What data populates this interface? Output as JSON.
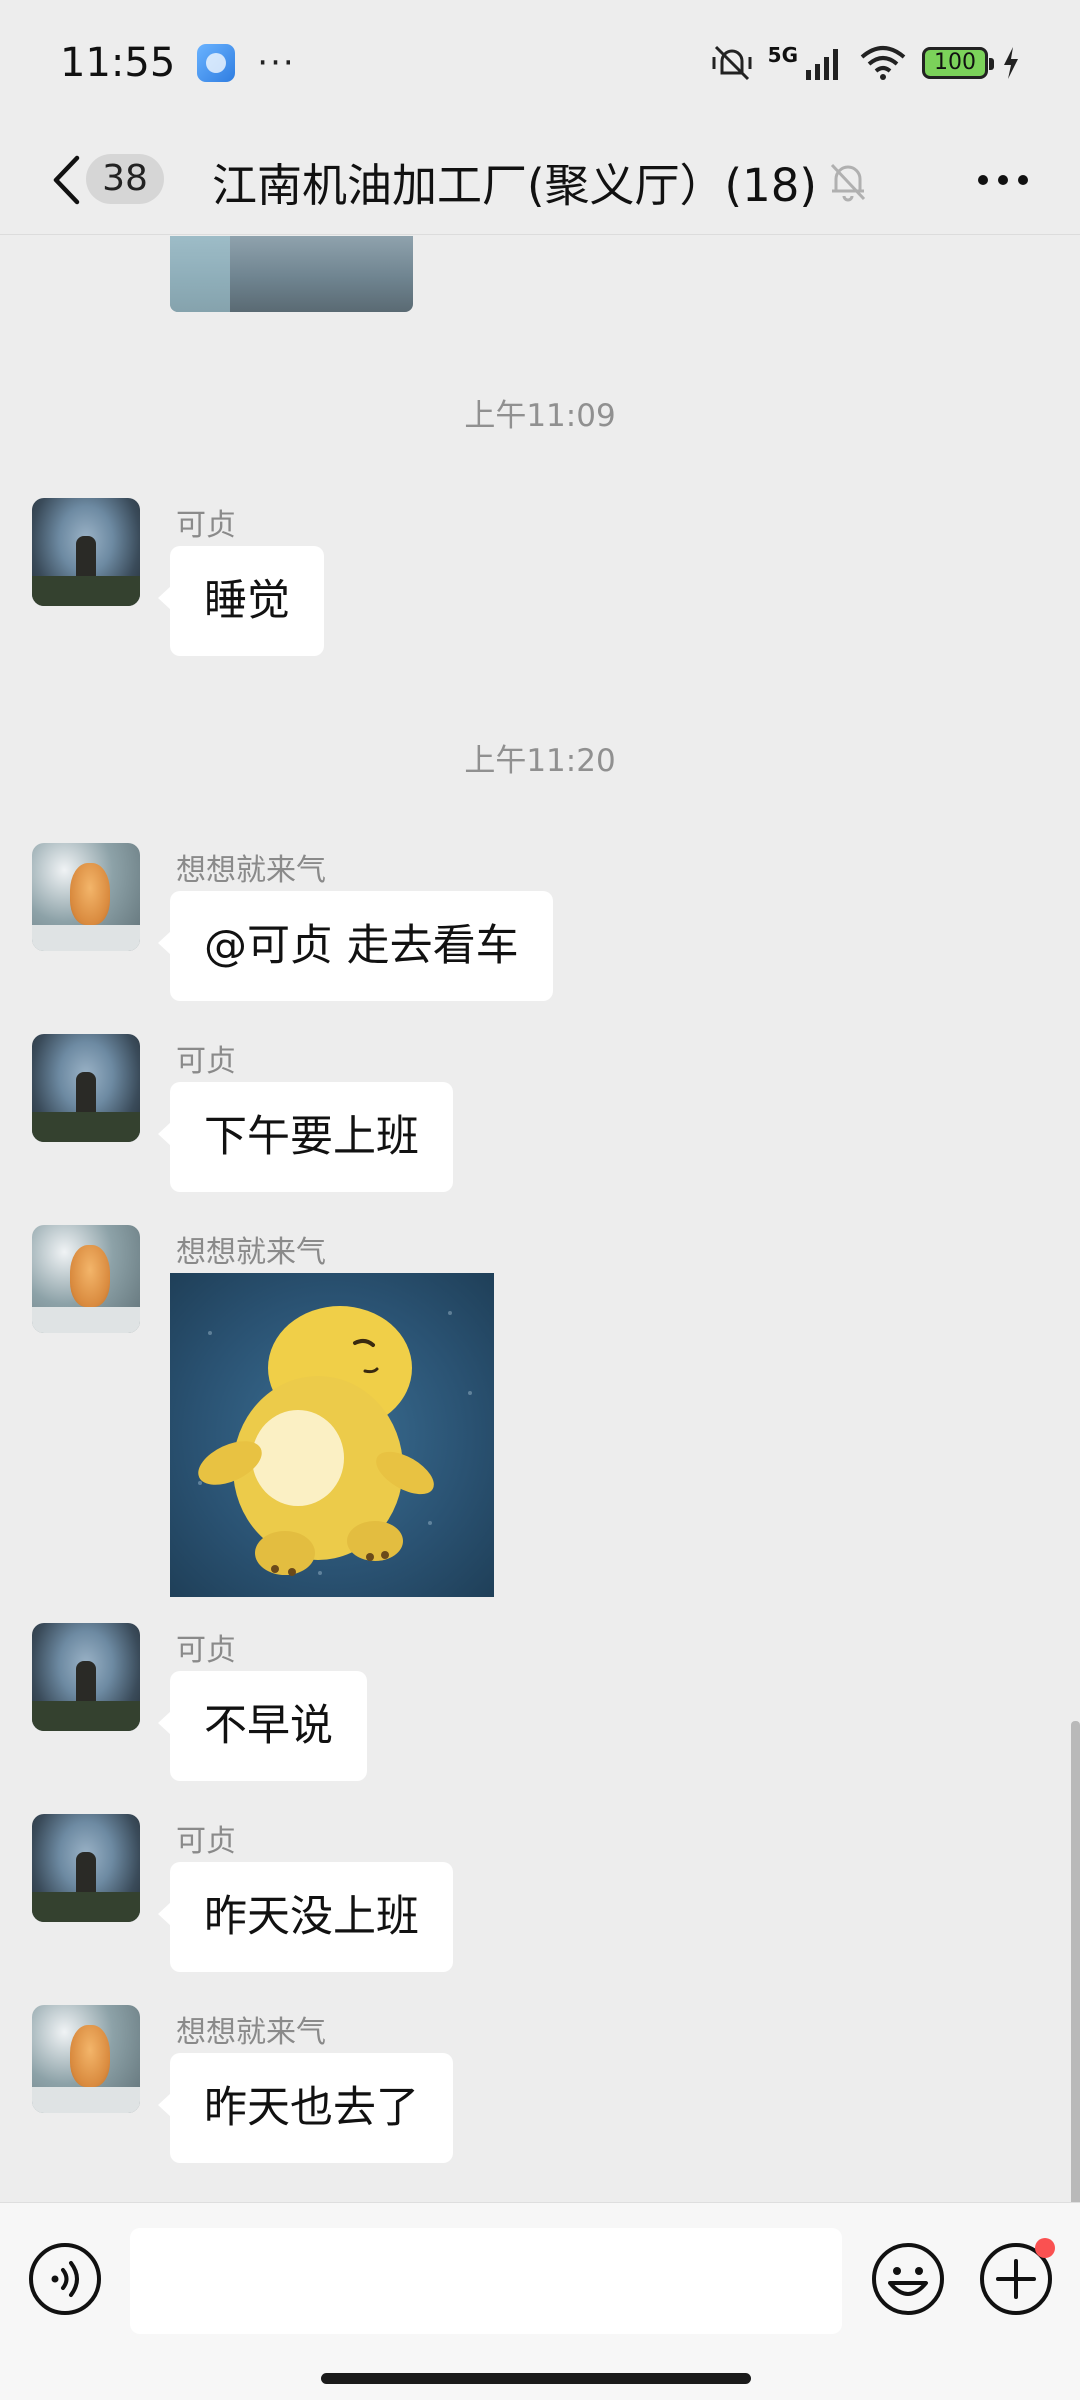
{
  "status_bar": {
    "time": "11:55",
    "dots": "···",
    "network": "5G",
    "battery": "100",
    "icons": [
      "app-notification-icon",
      "mute-vibrate-icon",
      "signal-icon",
      "wifi-icon",
      "battery-icon",
      "charging-icon"
    ]
  },
  "header": {
    "back_icon": "chevron-left-icon",
    "unread_count": "38",
    "title": "江南机油加工厂(聚义厅）(18)",
    "mute_icon": "bell-off-icon",
    "more_icon": "more-dots-icon"
  },
  "timestamps": [
    "上午11:09",
    "上午11:20"
  ],
  "messages": [
    {
      "sender": "可贞",
      "text": "睡觉",
      "avatar": "man"
    },
    {
      "sender": "想想就来气",
      "text": "@可贞  走去看车",
      "avatar": "cat"
    },
    {
      "sender": "可贞",
      "text": "下午要上班",
      "avatar": "man"
    },
    {
      "sender": "想想就来气",
      "text": "",
      "avatar": "cat",
      "type": "sticker"
    },
    {
      "sender": "可贞",
      "text": "不早说",
      "avatar": "man"
    },
    {
      "sender": "可贞",
      "text": "昨天没上班",
      "avatar": "man"
    },
    {
      "sender": "想想就来气",
      "text": "昨天也去了",
      "avatar": "cat"
    }
  ],
  "input": {
    "value": "",
    "voice_icon": "voice-icon",
    "emoji_icon": "emoji-icon",
    "plus_icon": "plus-icon"
  },
  "colors": {
    "background": "#ededed",
    "bubble": "#ffffff",
    "notification_dot": "#fa5151",
    "timestamp": "#909090"
  }
}
